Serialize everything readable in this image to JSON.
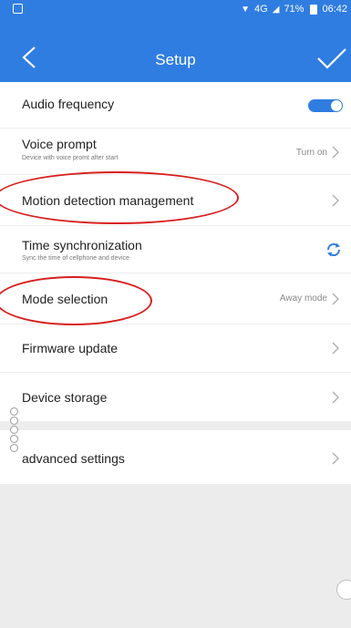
{
  "status_bar": {
    "network": "4G",
    "battery": "71%",
    "time": "06:42"
  },
  "header": {
    "title": "Setup",
    "back_icon": "chevron-left-icon",
    "confirm_icon": "check-icon"
  },
  "settings": {
    "audio_frequency": {
      "label": "Audio frequency",
      "toggle_on": true
    },
    "voice_prompt": {
      "label": "Voice prompt",
      "description": "Device with voice promt after start",
      "value": "Turn on"
    },
    "motion_detection": {
      "label": "Motion detection management"
    },
    "time_sync": {
      "label": "Time synchronization",
      "description": "Sync the time of cellphone and device"
    },
    "mode_selection": {
      "label": "Mode selection",
      "value": "Away mode"
    },
    "firmware_update": {
      "label": "Firmware update"
    },
    "device_storage": {
      "label": "Device storage"
    },
    "advanced": {
      "label": "advanced settings"
    }
  },
  "colors": {
    "accent": "#2f7de1",
    "annotation": "#d81f1f"
  }
}
